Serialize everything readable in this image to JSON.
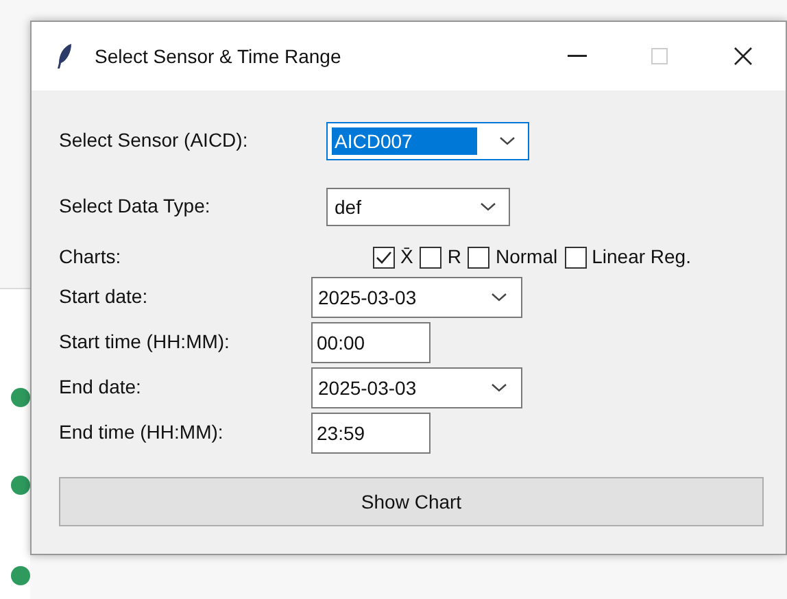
{
  "window": {
    "title": "Select Sensor & Time Range"
  },
  "rows": [
    {
      "kind": "combobox",
      "label": "Select Sensor (AICD):",
      "value": "AICD007",
      "selected": true
    },
    {
      "kind": "combobox",
      "label": "Select Data Type:",
      "value": "def",
      "selected": false
    },
    {
      "kind": "checks",
      "label": "Charts:",
      "options": [
        {
          "label": "X̄",
          "checked": true
        },
        {
          "label": "R",
          "checked": false
        },
        {
          "label": "Normal",
          "checked": false
        },
        {
          "label": "Linear Reg.",
          "checked": false
        }
      ]
    },
    {
      "kind": "date",
      "label": "Start date:",
      "value": "2025-03-03"
    },
    {
      "kind": "entry",
      "label": "Start time (HH:MM):",
      "value": "00:00"
    },
    {
      "kind": "date",
      "label": "End date:",
      "value": "2025-03-03"
    },
    {
      "kind": "entry",
      "label": "End time (HH:MM):",
      "value": "23:59"
    }
  ],
  "button": "Show Chart"
}
